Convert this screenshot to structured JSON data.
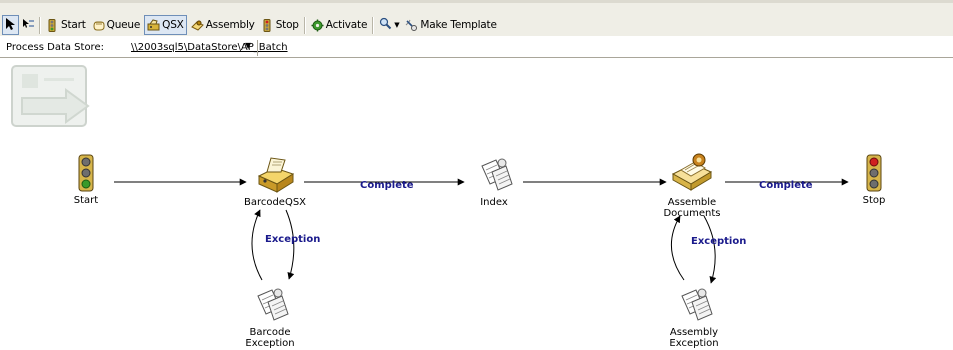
{
  "toolbar": {
    "items": [
      {
        "label": "Start",
        "icon": "traffic-light-icon"
      },
      {
        "label": "Queue",
        "icon": "hand-icon"
      },
      {
        "label": "QSX",
        "icon": "scanner-icon",
        "active": true
      },
      {
        "label": "Assembly",
        "icon": "assembly-icon"
      },
      {
        "label": "Stop",
        "icon": "traffic-light-icon"
      },
      {
        "label": "Activate",
        "icon": "gear-icon"
      },
      {
        "label": "Make Template",
        "icon": "template-icon"
      }
    ]
  },
  "store": {
    "label": "Process Data Store:",
    "value": "\\\\2003sql5\\DataStore\\AP_Batch"
  },
  "workflow": {
    "nodes": {
      "start": "Start",
      "barcode_qsx": "BarcodeQSX",
      "index": "Index",
      "assemble": [
        "Assemble",
        "Documents"
      ],
      "stop": "Stop",
      "barcode_exception": [
        "Barcode",
        "Exception"
      ],
      "assembly_exception": [
        "Assembly",
        "Exception"
      ]
    },
    "edges": {
      "complete_1": "Complete",
      "complete_2": "Complete",
      "exception_1": "Exception",
      "exception_2": "Exception"
    }
  },
  "colors": {
    "toolbar_bg": "#efeee6",
    "edge_label": "#1a1a8c",
    "light_green": "#3a9a2a",
    "light_red": "#d02020"
  }
}
